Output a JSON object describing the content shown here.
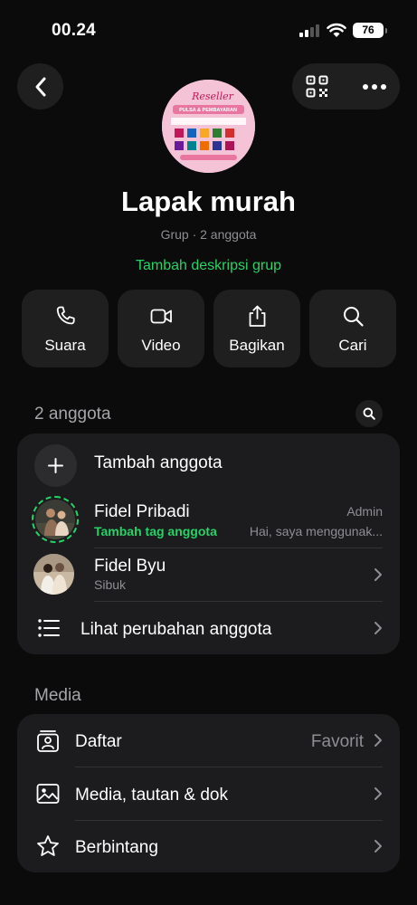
{
  "status": {
    "time": "00.24",
    "battery": "76"
  },
  "header": {
    "group_name": "Lapak murah",
    "group_meta": "Grup · 2 anggota",
    "add_description": "Tambah deskripsi grup",
    "avatar_text": "Reseller",
    "avatar_subtext": "PULSA & PEMBAYARAN"
  },
  "actions": [
    {
      "label": "Suara",
      "icon": "phone-icon"
    },
    {
      "label": "Video",
      "icon": "video-icon"
    },
    {
      "label": "Bagikan",
      "icon": "share-icon"
    },
    {
      "label": "Cari",
      "icon": "search-icon"
    }
  ],
  "members": {
    "title": "2 anggota",
    "add_label": "Tambah anggota",
    "list": [
      {
        "name": "Fidel Pribadi",
        "tag": "Tambah tag anggota",
        "role": "Admin",
        "status": "Hai, saya menggunak..."
      },
      {
        "name": "Fidel Byu",
        "status": "Sibuk"
      }
    ],
    "view_changes": "Lihat perubahan anggota"
  },
  "media": {
    "title": "Media",
    "rows": [
      {
        "label": "Daftar",
        "value": "Favorit",
        "icon": "list-card-icon"
      },
      {
        "label": "Media, tautan & dok",
        "icon": "image-icon"
      },
      {
        "label": "Berbintang",
        "icon": "star-icon"
      }
    ]
  },
  "colors": {
    "accent": "#25d366",
    "background": "#0b0b0b",
    "card": "#1c1c1e"
  }
}
